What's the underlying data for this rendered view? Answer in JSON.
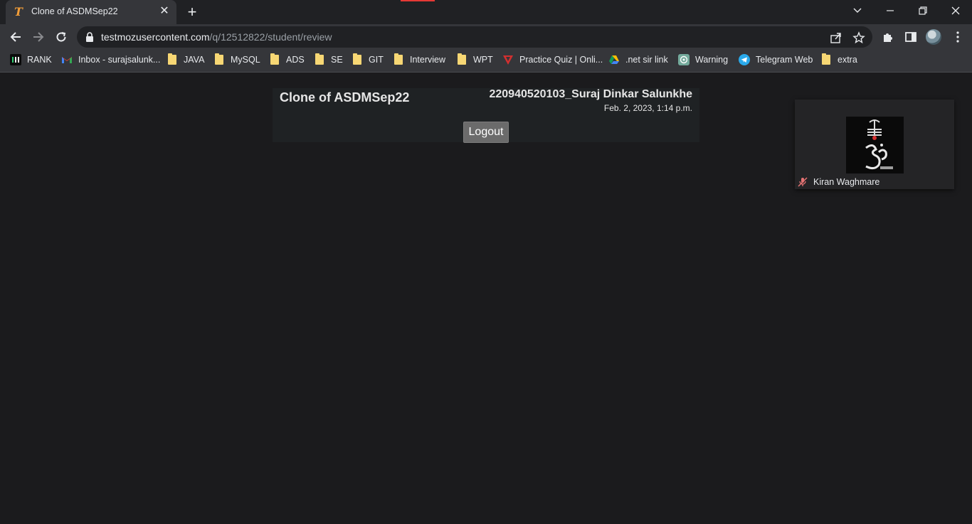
{
  "browser": {
    "tab": {
      "title": "Clone of ASDMSep22",
      "favicon": "testmoz-T-icon"
    },
    "url": {
      "host": "testmozusercontent.com",
      "path": "/q/12512822/student/review"
    },
    "bookmarks": [
      {
        "label": "RANK",
        "icon": "rank-icon"
      },
      {
        "label": "Inbox - surajsalunk...",
        "icon": "gmail-icon"
      },
      {
        "label": "JAVA",
        "icon": "folder-icon"
      },
      {
        "label": "MySQL",
        "icon": "folder-icon"
      },
      {
        "label": "ADS",
        "icon": "folder-icon"
      },
      {
        "label": "SE",
        "icon": "folder-icon"
      },
      {
        "label": "GIT",
        "icon": "folder-icon"
      },
      {
        "label": "Interview",
        "icon": "folder-icon"
      },
      {
        "label": "WPT",
        "icon": "folder-icon"
      },
      {
        "label": "Practice Quiz | Onli...",
        "icon": "practice-quiz-icon"
      },
      {
        "label": ".net sir link",
        "icon": "google-drive-icon"
      },
      {
        "label": "Warning",
        "icon": "chatgpt-icon"
      },
      {
        "label": "Telegram Web",
        "icon": "telegram-icon"
      },
      {
        "label": "extra",
        "icon": "folder-icon"
      }
    ]
  },
  "quiz": {
    "title": "Clone of ASDMSep22",
    "student": "220940520103_Suraj Dinkar Salunkhe",
    "datetime": "Feb. 2, 2023, 1:14 p.m.",
    "logout_label": "Logout"
  },
  "video": {
    "participant_name": "Kiran Waghmare",
    "mic_status": "muted"
  },
  "colors": {
    "page_bg": "#1b1b1d",
    "header_bg": "#1f2224",
    "button_bg": "#6b6b6b",
    "favicon": "#f29d38"
  }
}
